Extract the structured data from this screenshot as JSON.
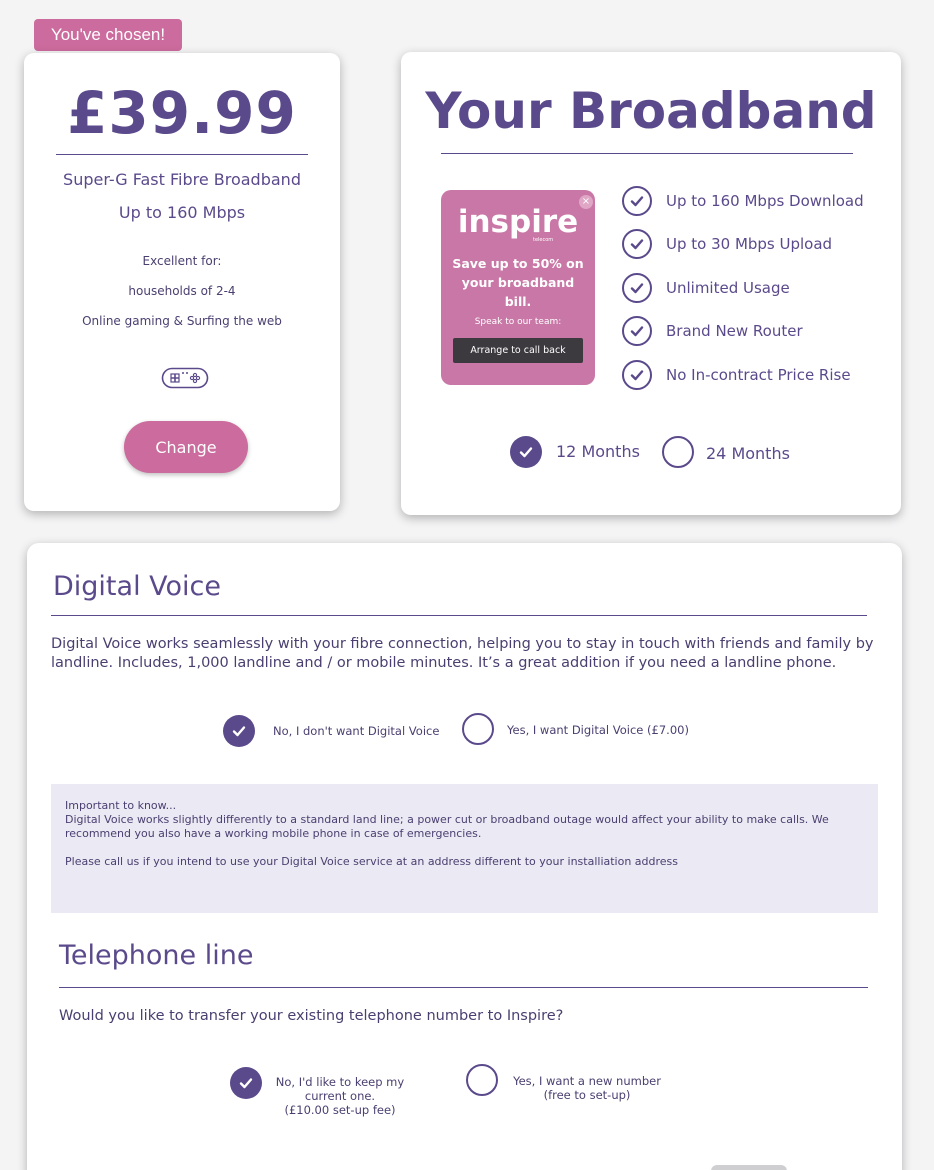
{
  "badge": "You've chosen!",
  "package": {
    "price": "£39.99",
    "name": "Super-G Fast Fibre Broadband",
    "speed": "Up to 160 Mbps",
    "excellent_for": "Excellent for:",
    "use_1": "households of 2-4",
    "use_2": "Online gaming & Surfing the web",
    "icon": "gamepad-icon",
    "change_label": "Change"
  },
  "broadband": {
    "title": "Your Broadband",
    "promo": {
      "logo": "inspire",
      "logo_sub": "telecom",
      "headline": "Save up to 50% on your broadband bill.",
      "subtext": "Speak to our team:",
      "button": "Arrange to call back",
      "close": "×"
    },
    "features": [
      "Up to 160 Mbps Download",
      "Up to 30 Mbps Upload",
      "Unlimited Usage",
      "Brand New Router",
      "No In-contract Price Rise"
    ],
    "terms": {
      "option_1": "12 Months",
      "option_2": "24 Months",
      "selected": "12 Months"
    }
  },
  "digital_voice": {
    "title": "Digital Voice",
    "description": "Digital Voice works seamlessly with your fibre connection, helping you to stay in touch with friends and family by landline. Includes, 1,000 landline and / or mobile minutes. It’s a great addition if you need a landline phone.",
    "option_no": "No, I don't want Digital Voice",
    "option_yes": "Yes, I want Digital Voice (£7.00)",
    "selected": "No, I don't want Digital Voice",
    "notice_heading": "Important to know...",
    "notice_body": "Digital Voice works slightly differently to a standard land line; a power cut or broadband outage would affect your ability to make calls. We recommend you also have a working mobile phone in case of emergencies.",
    "notice_address": "Please call us if you intend to use your Digital Voice service at an address different to your installiation address"
  },
  "telephone": {
    "title": "Telephone line",
    "question": "Would you like to transfer your existing telephone number to Inspire?",
    "option_keep_1": "No, I'd like to keep my",
    "option_keep_2": "current one.",
    "option_keep_3": "(£10.00 set-up fee)",
    "option_new_1": "Yes, I want a new number",
    "option_new_2": "(free to set-up)",
    "selected": "keep"
  },
  "colors": {
    "brand_purple": "#5b4a8b",
    "brand_pink": "#cc6b9d",
    "notice_bg": "#ebe9f3"
  }
}
